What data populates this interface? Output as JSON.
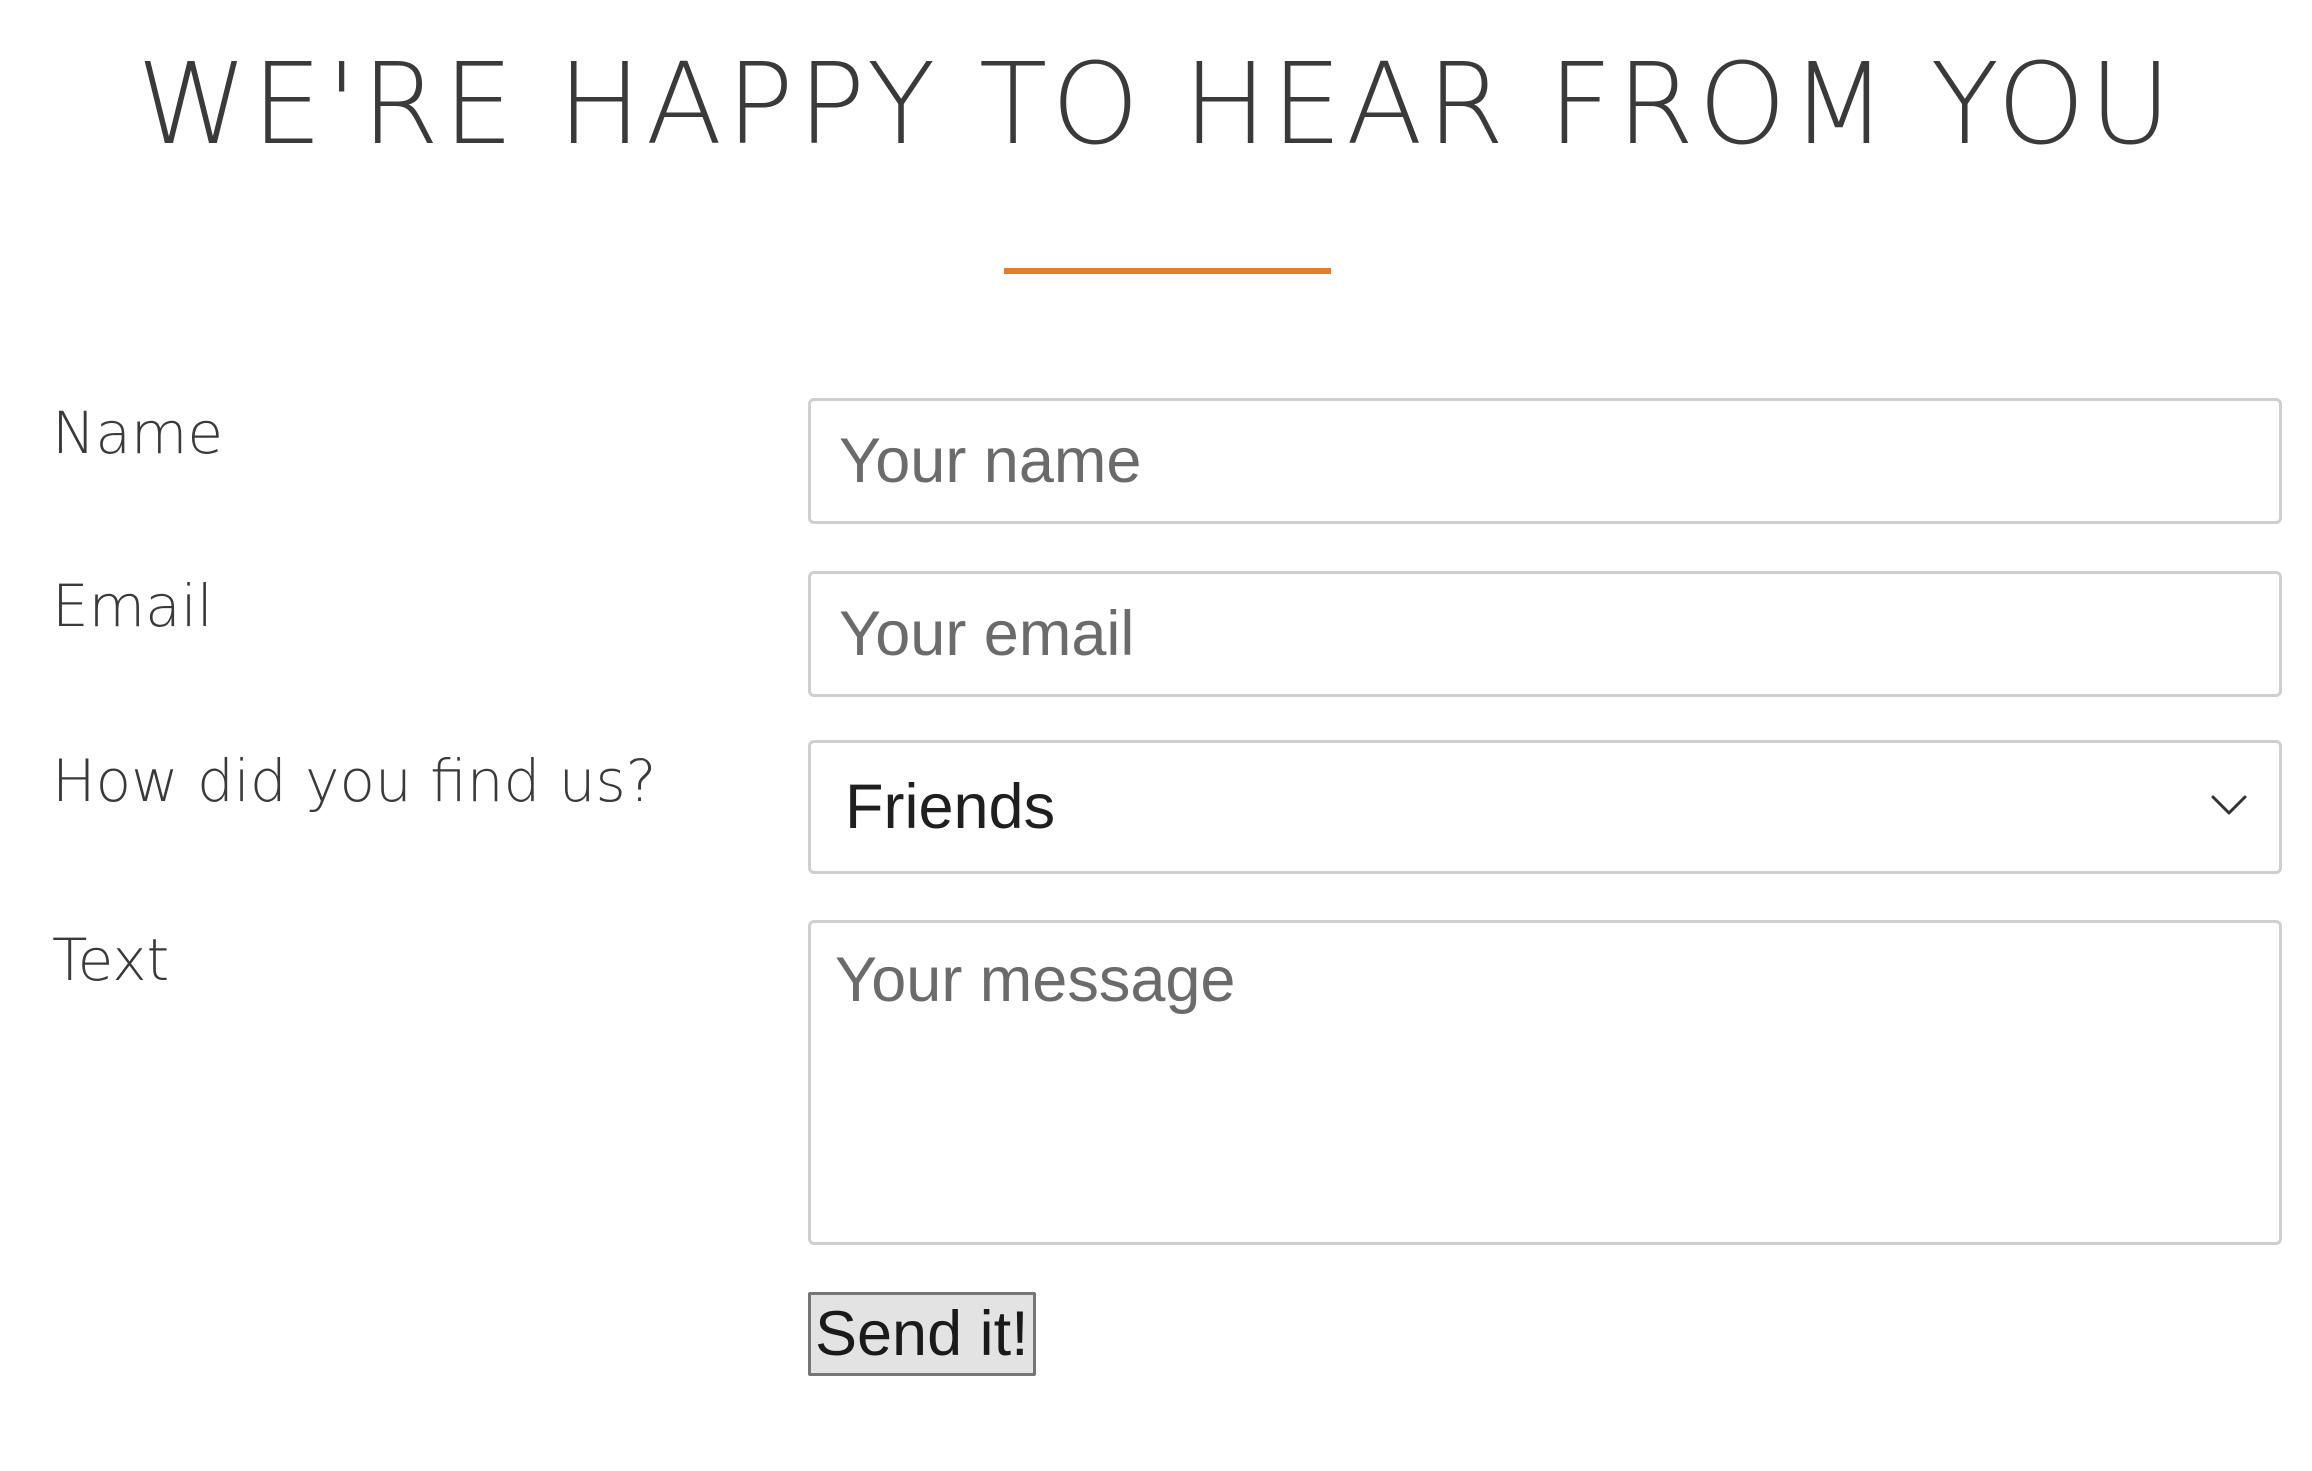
{
  "header": {
    "title": "WE'RE HAPPY TO HEAR FROM YOU"
  },
  "colors": {
    "accent": "#e87b2a",
    "text": "#3a3a3a",
    "field_border": "#cfcfcf",
    "button_bg": "#e3e3e3"
  },
  "form": {
    "name": {
      "label": "Name",
      "placeholder": "Your name",
      "value": ""
    },
    "email": {
      "label": "Email",
      "placeholder": "Your email",
      "value": ""
    },
    "source": {
      "label": "How did you find us?",
      "selected": "Friends",
      "icon": "chevron-down-icon"
    },
    "message": {
      "label": "Text",
      "placeholder": "Your message",
      "value": ""
    },
    "submit": {
      "label": "Send it!"
    }
  }
}
